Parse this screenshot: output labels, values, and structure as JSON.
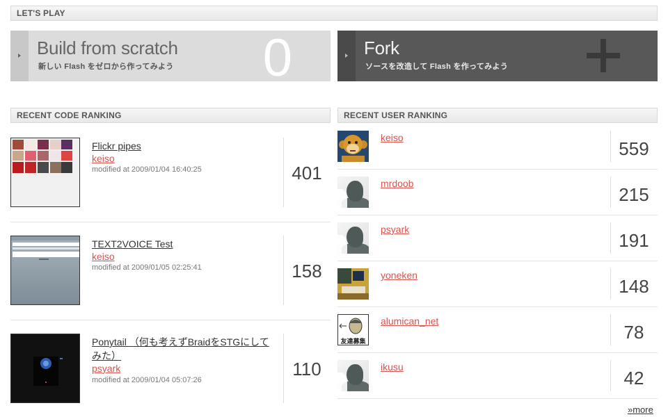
{
  "lets_play": {
    "header": "LET'S PLAY",
    "build": {
      "title": "Build from scratch",
      "subtitle": "新しい Flash をゼロから作ってみよう",
      "big_glyph": "0"
    },
    "fork": {
      "title": "Fork",
      "subtitle": "ソースを改造して Flash を作ってみよう"
    }
  },
  "code_ranking": {
    "header": "RECENT CODE RANKING",
    "items": [
      {
        "title": "Flickr pipes",
        "user": "keiso",
        "modified": "modified at 2009/01/04 16:40:25",
        "score": "401"
      },
      {
        "title": "TEXT2VOICE Test",
        "user": "keiso",
        "modified": "modified at 2009/01/05 02:25:41",
        "score": "158"
      },
      {
        "title": "Ponytail （何も考えずBraidをSTGにしてみた）",
        "user": "psyark",
        "modified": "modified at 2009/01/04 05:07:26",
        "score": "110"
      }
    ]
  },
  "user_ranking": {
    "header": "RECENT USER RANKING",
    "items": [
      {
        "name": "keiso",
        "score": "559",
        "avatar": "monkey-avatar"
      },
      {
        "name": "mrdoob",
        "score": "215",
        "avatar": "default-silhouette-avatar"
      },
      {
        "name": "psyark",
        "score": "191",
        "avatar": "default-silhouette-avatar"
      },
      {
        "name": "yoneken",
        "score": "148",
        "avatar": "desk-photo-avatar"
      },
      {
        "name": "alumican_net",
        "score": "78",
        "avatar": "friend-recruit-avatar",
        "avatar_text": "友達募集"
      },
      {
        "name": "ikusu",
        "score": "42",
        "avatar": "default-silhouette-avatar"
      }
    ],
    "more_label": "»more"
  },
  "colors": {
    "link_red": "#d9534f",
    "fork_bg": "#585858",
    "scratch_bg": "#dcdcdc"
  }
}
